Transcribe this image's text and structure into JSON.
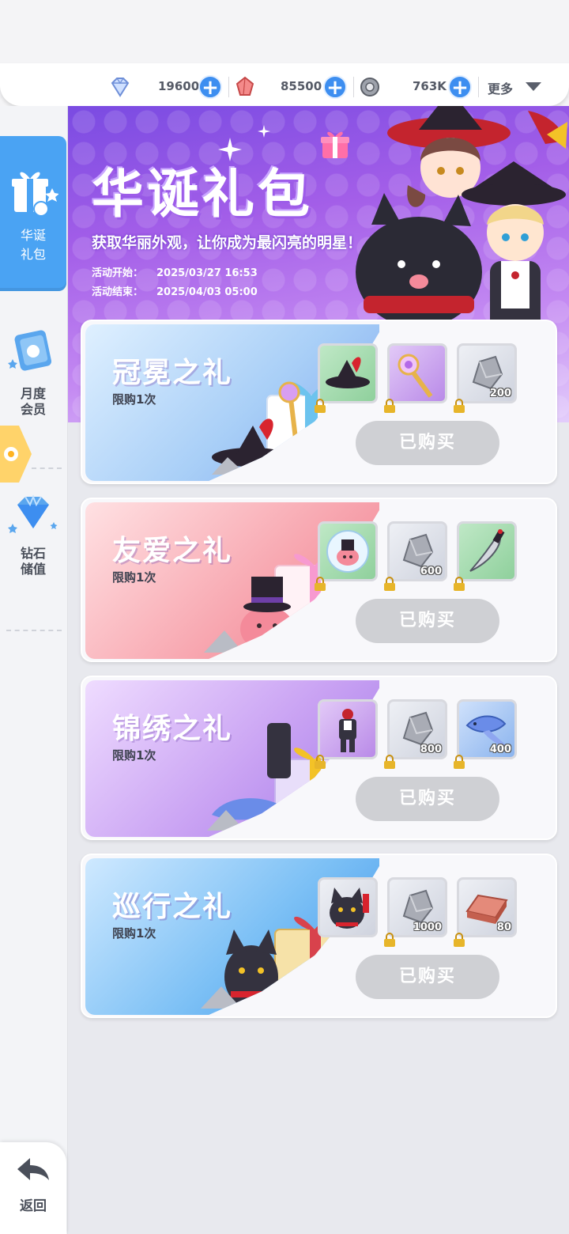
{
  "currencies": [
    {
      "icon": "diamond-icon",
      "value": "19600"
    },
    {
      "icon": "red-crystal-icon",
      "value": "85500"
    },
    {
      "icon": "gear-coin-icon",
      "value": "763K"
    }
  ],
  "topbar": {
    "more_label": "更多"
  },
  "sidebar": {
    "items": [
      {
        "label_line1": "华诞",
        "label_line2": "礼包",
        "icon": "gift-icon"
      },
      {
        "label_line1": "月度",
        "label_line2": "会员",
        "icon": "membership-card-icon"
      },
      {
        "label_line1": "钻石",
        "label_line2": "储值",
        "icon": "diamond-icon"
      }
    ],
    "back_label": "返回"
  },
  "banner": {
    "title": "华诞礼包",
    "subtitle": "获取华丽外观，让你成为最闪亮的明星！",
    "start_label": "活动开始：",
    "start_value": "2025/03/27 16:53",
    "end_label": "活动结束：",
    "end_value": "2025/04/03 05:00"
  },
  "packs": [
    {
      "name": "冠冕之礼",
      "limit": "限购1次",
      "button": "已购买",
      "theme": "blue",
      "items": [
        {
          "icon": "witch-hat-icon",
          "bg": "green",
          "qty": "",
          "locked": true
        },
        {
          "icon": "magic-wand-icon",
          "bg": "purple",
          "qty": "",
          "locked": true
        },
        {
          "icon": "stone-ore-icon",
          "bg": "gray",
          "qty": "200",
          "locked": true
        }
      ]
    },
    {
      "name": "友爱之礼",
      "limit": "限购1次",
      "button": "已购买",
      "theme": "pink",
      "items": [
        {
          "icon": "pink-slime-bubble-icon",
          "bg": "green",
          "qty": "",
          "locked": true
        },
        {
          "icon": "stone-ore-icon",
          "bg": "gray",
          "qty": "600",
          "locked": true
        },
        {
          "icon": "dagger-icon",
          "bg": "green",
          "qty": "",
          "locked": true
        }
      ]
    },
    {
      "name": "锦绣之礼",
      "limit": "限购1次",
      "button": "已购买",
      "theme": "purple",
      "items": [
        {
          "icon": "costume-outfit-icon",
          "bg": "purple",
          "qty": "",
          "locked": true
        },
        {
          "icon": "stone-ore-icon",
          "bg": "gray",
          "qty": "800",
          "locked": true
        },
        {
          "icon": "blue-fish-icon",
          "bg": "blue",
          "qty": "400",
          "locked": true
        }
      ]
    },
    {
      "name": "巡行之礼",
      "limit": "限购1次",
      "button": "已购买",
      "theme": "sky",
      "items": [
        {
          "icon": "black-cat-mount-icon",
          "bg": "gray",
          "qty": "",
          "locked": false
        },
        {
          "icon": "stone-ore-icon",
          "bg": "gray",
          "qty": "1000",
          "locked": true
        },
        {
          "icon": "copper-ingot-icon",
          "bg": "red",
          "qty": "80",
          "locked": true
        }
      ]
    }
  ],
  "colors": {
    "accent_blue": "#4aa3f3",
    "plus_blue": "#3d8ef0",
    "button_disabled": "#cfd0d4"
  }
}
